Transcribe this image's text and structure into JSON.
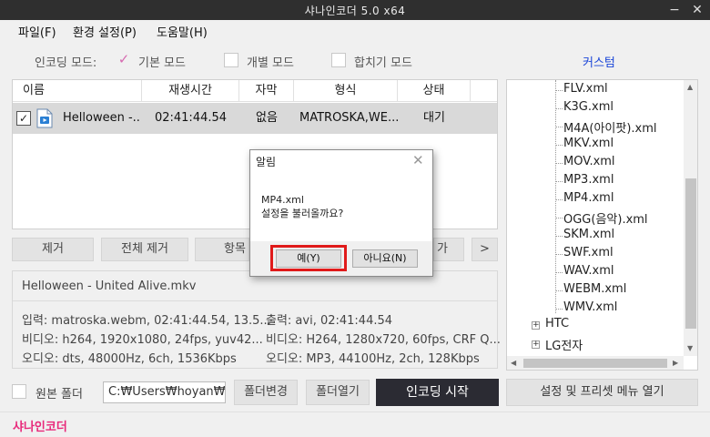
{
  "window": {
    "title": "샤나인코더  5.0 x64",
    "minimize_icon": "minimize-icon",
    "close_icon": "close-icon"
  },
  "menu": {
    "items": [
      "파일(F)",
      "환경 설정(P)",
      "도움말(H)"
    ]
  },
  "mode_bar": {
    "label": "인코딩 모드:",
    "options": [
      {
        "label": "기본 모드",
        "checked": true
      },
      {
        "label": "개별 모드",
        "checked": false
      },
      {
        "label": "합치기 모드",
        "checked": false
      }
    ],
    "custom_link": "커스텀"
  },
  "file_list": {
    "columns": [
      "이름",
      "재생시간",
      "자막",
      "형식",
      "상태"
    ],
    "rows": [
      {
        "checked": true,
        "name": "Helloween -...",
        "duration": "02:41:44.54",
        "subtitle": "없음",
        "format": "MATROSKA,WE...",
        "status": "대기"
      }
    ]
  },
  "actions": {
    "remove": "제거",
    "remove_all": "전체 제거",
    "item_partial": "항목",
    "partial_right": "가",
    "next": ">"
  },
  "info": {
    "filename": "Helloween - United Alive.mkv",
    "input": "입력: matroska.webm, 02:41:44.54, 13.5...",
    "video_in": "비디오: h264, 1920x1080, 24fps,  yuv42...",
    "audio_in": "오디오: dts, 48000Hz, 6ch, 1536Kbps",
    "output": "출력: avi, 02:41:44.54",
    "video_out": "비디오: H264, 1280x720, 60fps, CRF Q...",
    "audio_out": "오디오: MP3, 44100Hz, 2ch, 128Kbps"
  },
  "tree": {
    "items": [
      "FLV.xml",
      "K3G.xml",
      "M4A(아이팟).xml",
      "MKV.xml",
      "MOV.xml",
      "MP3.xml",
      "MP4.xml",
      "OGG(음악).xml",
      "SKM.xml",
      "SWF.xml",
      "WAV.xml",
      "WEBM.xml",
      "WMV.xml"
    ],
    "groups": [
      "HTC",
      "LG전자"
    ]
  },
  "bottom": {
    "source_folder_label": "원본 폴더",
    "path": "C:₩Users₩hoyan₩De",
    "change_folder": "폴더변경",
    "open_folder": "폴더열기",
    "start": "인코딩 시작",
    "settings": "설정 및 프리셋 메뉴 열기"
  },
  "footer": {
    "brand": "샤나인코더"
  },
  "dialog": {
    "title": "알림",
    "message_line1": "MP4.xml",
    "message_line2": "설정을 불러올까요?",
    "yes": "예(Y)",
    "no": "아니요(N)",
    "highlight_color": "#e01a1a"
  }
}
